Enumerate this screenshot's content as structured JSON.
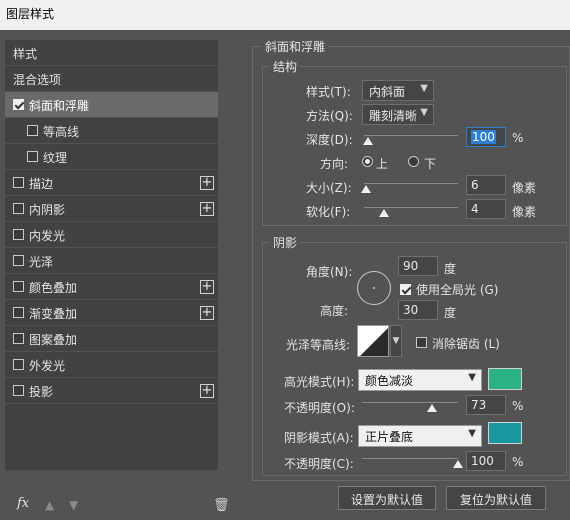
{
  "window": {
    "title": "图层样式"
  },
  "sidebar": {
    "items": [
      {
        "label": "样式"
      },
      {
        "label": "混合选项"
      },
      {
        "label": "斜面和浮雕",
        "checked": true
      },
      {
        "label": "等高线",
        "checked": false
      },
      {
        "label": "纹理",
        "checked": false
      },
      {
        "label": "描边",
        "checked": false
      },
      {
        "label": "内阴影",
        "checked": false
      },
      {
        "label": "内发光",
        "checked": false
      },
      {
        "label": "光泽",
        "checked": false
      },
      {
        "label": "颜色叠加",
        "checked": false
      },
      {
        "label": "渐变叠加",
        "checked": false
      },
      {
        "label": "图案叠加",
        "checked": false
      },
      {
        "label": "外发光",
        "checked": false
      },
      {
        "label": "投影",
        "checked": false
      }
    ],
    "fx": "fx",
    "plus": "+"
  },
  "bevel": {
    "section_title": "斜面和浮雕",
    "structure_title": "结构",
    "style_label": "样式(T):",
    "style_value": "内斜面",
    "technique_label": "方法(Q):",
    "technique_value": "雕刻清晰",
    "depth_label": "深度(D):",
    "depth_value": "100",
    "depth_unit": "%",
    "direction_label": "方向:",
    "direction_up": "上",
    "direction_down": "下",
    "size_label": "大小(Z):",
    "size_value": "6",
    "size_unit": "像素",
    "soften_label": "软化(F):",
    "soften_value": "4",
    "soften_unit": "像素",
    "shading_title": "阴影",
    "angle_label": "角度(N):",
    "angle_value": "90",
    "angle_unit": "度",
    "global_light_label": "使用全局光 (G)",
    "global_light_checked": true,
    "altitude_label": "高度:",
    "altitude_value": "30",
    "altitude_unit": "度",
    "gloss_label": "光泽等高线:",
    "antialias_label": "消除锯齿 (L)",
    "highlight_mode_label": "高光模式(H):",
    "highlight_mode_value": "颜色减淡",
    "highlight_color": "#2bb284",
    "highlight_opacity_label": "不透明度(O):",
    "highlight_opacity_value": "73",
    "highlight_opacity_unit": "%",
    "shadow_mode_label": "阴影模式(A):",
    "shadow_mode_value": "正片叠底",
    "shadow_color": "#1899a0",
    "shadow_opacity_label": "不透明度(C):",
    "shadow_opacity_value": "100",
    "shadow_opacity_unit": "%",
    "make_default": "设置为默认值",
    "reset_default": "复位为默认值"
  }
}
